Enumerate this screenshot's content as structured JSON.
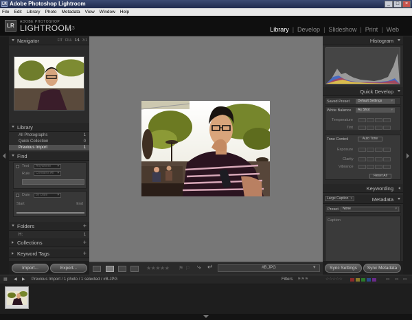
{
  "window": {
    "app_icon": "LR",
    "title": "Adobe Photoshop Lightroom",
    "controls": [
      "_",
      "□",
      "×"
    ]
  },
  "menu": [
    "File",
    "Edit",
    "Library",
    "Photo",
    "Metadata",
    "View",
    "Window",
    "Help"
  ],
  "identity": {
    "badge": "LR",
    "brand_small": "ADOBE PHOTOSHOP",
    "brand": "LIGHTROOM",
    "version": "L3"
  },
  "modules": [
    {
      "label": "Library",
      "active": true
    },
    {
      "label": "Develop",
      "active": false
    },
    {
      "label": "Slideshow",
      "active": false
    },
    {
      "label": "Print",
      "active": false
    },
    {
      "label": "Web",
      "active": false
    }
  ],
  "left_panel": {
    "navigator": {
      "title": "Navigator",
      "zoom_options": [
        "FIT",
        "FILL",
        "1:1",
        "3:1"
      ],
      "active_zoom": "1:1"
    },
    "library": {
      "title": "Library",
      "items": [
        {
          "label": "All Photographs",
          "count": "1"
        },
        {
          "label": "Quick Collection",
          "count": "0"
        },
        {
          "label": "Previous Import",
          "count": "1"
        }
      ]
    },
    "find": {
      "title": "Find",
      "text_label": "Text",
      "text_dropdown": "Anywhere",
      "rule_label": "Rule",
      "rule_dropdown": "Contains All",
      "date_label": "Date",
      "date_dropdown": "by Date",
      "start_label": "Start",
      "end_label": "End"
    },
    "folders": {
      "title": "Folders",
      "item": "H:",
      "count": "1"
    },
    "collections": {
      "title": "Collections"
    },
    "keyword_tags": {
      "title": "Keyword Tags"
    },
    "import_button": "Import...",
    "export_button": "Export..."
  },
  "toolbar": {
    "stars": "★★★★★",
    "filename": "#B.JPG"
  },
  "right_panel": {
    "histogram": {
      "title": "Histogram"
    },
    "quick_develop": {
      "title": "Quick Develop",
      "saved_preset_label": "Saved Preset",
      "saved_preset_value": "Default Settings",
      "white_balance_label": "White Balance",
      "white_balance_value": "As Shot",
      "temperature_label": "Temperature",
      "tint_label": "Tint",
      "tone_control_label": "Tone Control",
      "auto_tone": "Auto Tone",
      "exposure_label": "Exposure",
      "clarity_label": "Clarity",
      "vibrance_label": "Vibrance",
      "reset_all": "Reset All"
    },
    "keywording": {
      "title": "Keywording"
    },
    "metadata": {
      "title": "Metadata",
      "view_option": "Large Caption",
      "preset_label": "Preset",
      "preset_value": "None",
      "caption_label": "Caption"
    },
    "sync_settings": "Sync Settings",
    "sync_metadata": "Sync Metadata"
  },
  "filmstrip": {
    "breadcrumb": "Previous Import / 1 photo / 1 selected / #B.JPG",
    "filters_label": "Filters"
  },
  "colors": {
    "panel": "#2b2b2b",
    "center": "#777777",
    "selection": "#505050"
  }
}
